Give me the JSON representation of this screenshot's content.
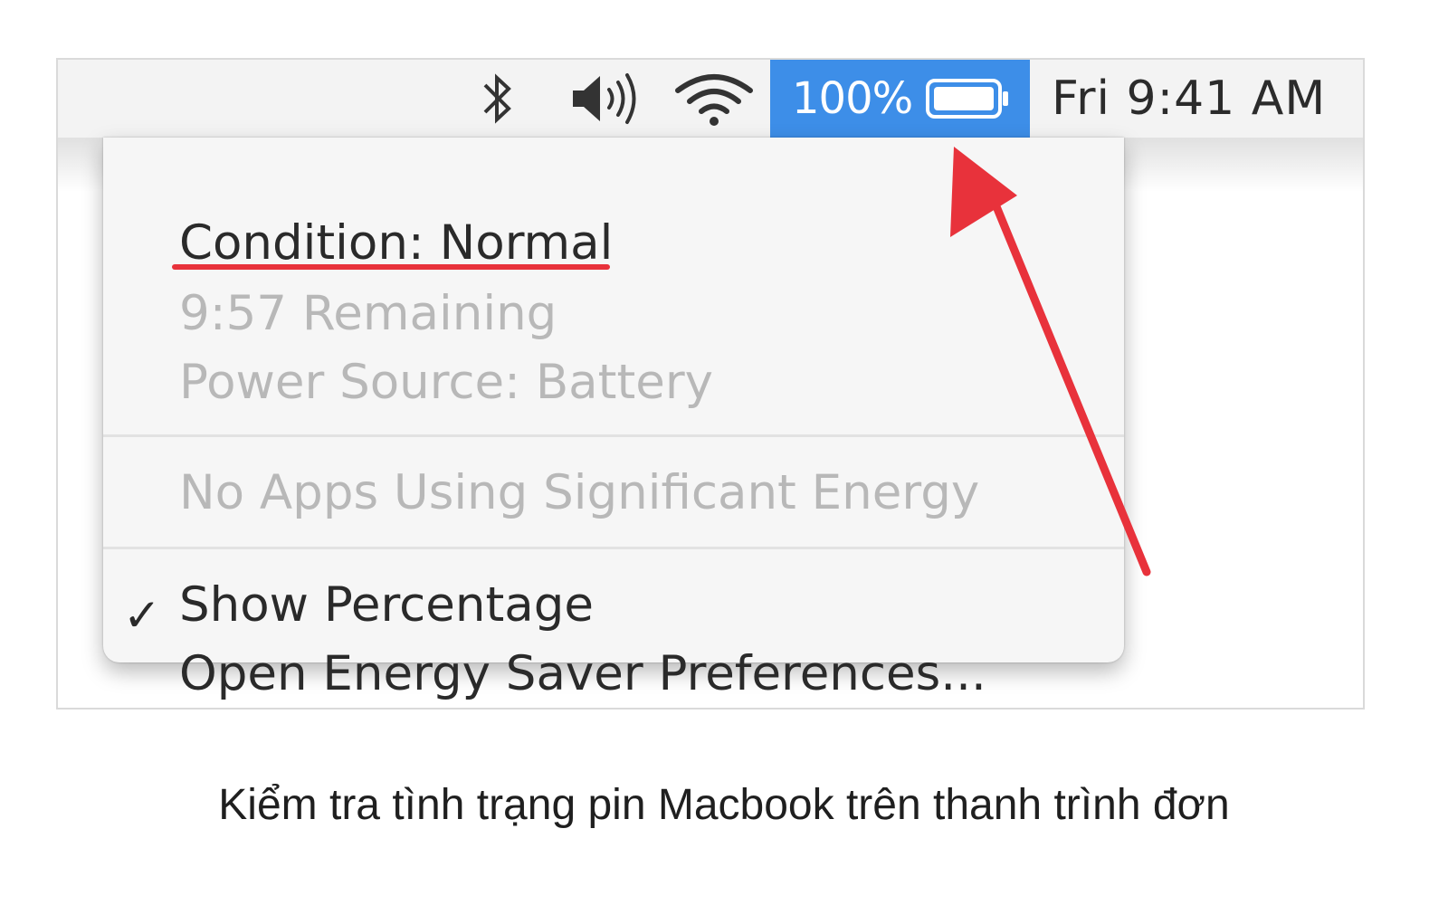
{
  "menubar": {
    "icons": [
      "bluetooth-icon",
      "volume-icon",
      "wifi-icon",
      "battery-icon"
    ],
    "battery_percentage": "100%",
    "battery_level": 1.0,
    "clock": "Fri 9:41 AM",
    "highlight_color": "#3d8ee8"
  },
  "battery_menu": {
    "condition": "Condition: Normal",
    "remaining": "9:57 Remaining",
    "power_source": "Power Source: Battery",
    "energy_apps": "No Apps Using Significant Energy",
    "show_percentage": "Show Percentage",
    "show_percentage_checked": true,
    "check_mark": "✓",
    "preferences": "Open Energy Saver Preferences..."
  },
  "annotation": {
    "arrow_color": "#e8323b",
    "underline_color": "#e8323b"
  },
  "caption": "Kiểm tra tình trạng pin Macbook trên thanh trình đơn"
}
